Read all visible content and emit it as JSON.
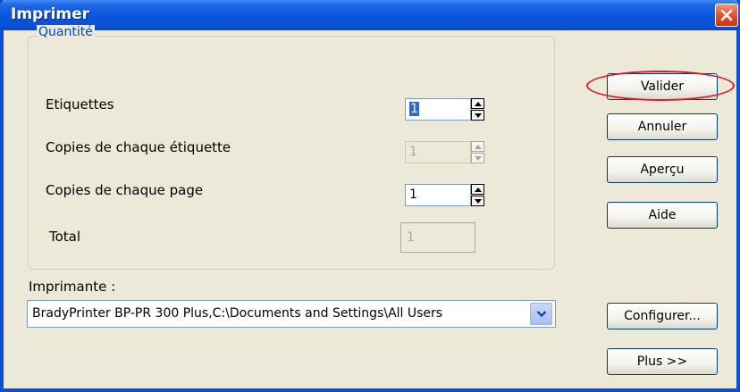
{
  "window": {
    "title": "Imprimer"
  },
  "quantite": {
    "legend": "Quantité",
    "etiquettes": {
      "label": "Etiquettes",
      "value": "1"
    },
    "copies_etiquette": {
      "label": "Copies de chaque étiquette",
      "value": "1"
    },
    "copies_page": {
      "label": "Copies de chaque page",
      "value": "1"
    },
    "total": {
      "label": "Total",
      "value": "1"
    }
  },
  "buttons": {
    "valider": "Valider",
    "annuler": "Annuler",
    "apercu": "Aperçu",
    "aide": "Aide",
    "configurer": "Configurer...",
    "plus": "Plus >>"
  },
  "printer": {
    "label": "Imprimante :",
    "selected": "BradyPrinter BP-PR 300 Plus,C:\\Documents and Settings\\All Users"
  },
  "colors": {
    "titlebar": "#0a55dd",
    "legend": "#0046d5",
    "highlight": "#e0182a",
    "selection": "#316ac5"
  }
}
